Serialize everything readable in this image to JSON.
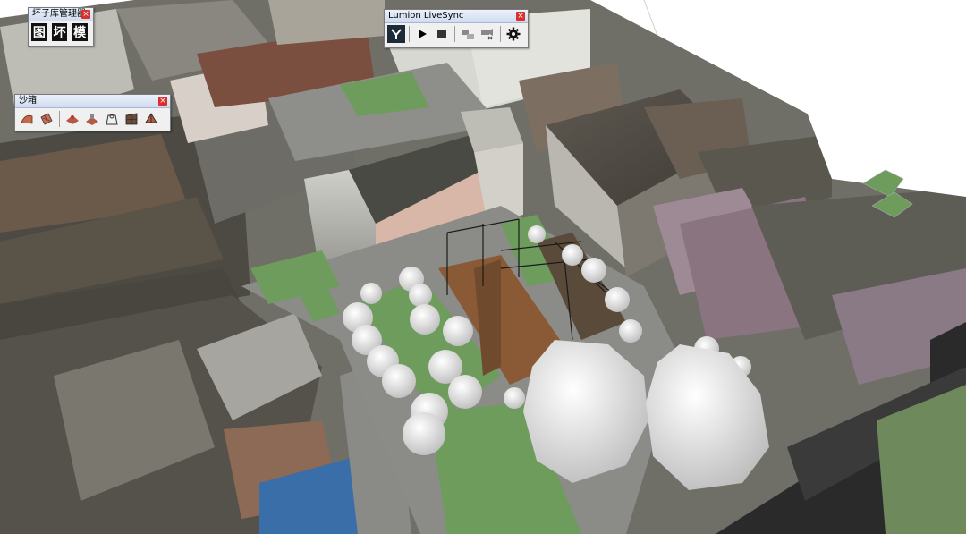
{
  "panels": {
    "asset_manager": {
      "title": "坏子库管理器",
      "close": "×",
      "buttons": [
        {
          "label": "图",
          "icon": "asset-library-icon"
        },
        {
          "label": "坏",
          "icon": "asset-bad-icon"
        },
        {
          "label": "模",
          "icon": "model-icon"
        }
      ]
    },
    "livesync": {
      "title": "Lumion LiveSync",
      "close": "×",
      "buttons": [
        {
          "icon": "lumion-logo-icon"
        },
        {
          "icon": "play-icon"
        },
        {
          "icon": "stop-icon"
        },
        {
          "icon": "sync-camera-icon"
        },
        {
          "icon": "camera-off-icon"
        },
        {
          "icon": "settings-gear-icon"
        }
      ]
    },
    "sandbox": {
      "title": "沙箱",
      "close": "×",
      "buttons": [
        {
          "icon": "from-contours-icon"
        },
        {
          "icon": "from-scratch-icon"
        },
        {
          "icon": "smoove-icon"
        },
        {
          "icon": "stamp-icon"
        },
        {
          "icon": "drape-icon"
        },
        {
          "icon": "add-detail-icon"
        },
        {
          "icon": "flip-edge-icon"
        }
      ]
    }
  },
  "colors": {
    "grass": "#6e9c5c",
    "paving": "#8a8a8a",
    "road": "#2a2a2a",
    "deck": "#8a5a36",
    "tree": "#f2f2f2",
    "roof": "#6b5f52"
  }
}
